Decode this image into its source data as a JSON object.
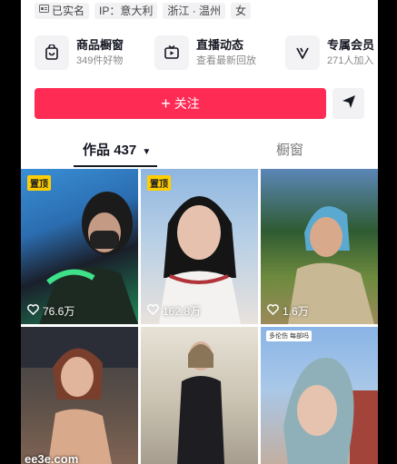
{
  "profile_tags": [
    {
      "icon": "id-card-icon",
      "label": "已实名"
    },
    {
      "icon": "",
      "label": "IP：意大利"
    },
    {
      "icon": "",
      "label": "浙江 · 温州"
    },
    {
      "icon": "",
      "label": "女"
    }
  ],
  "features": [
    {
      "title": "商品橱窗",
      "subtitle": "349件好物",
      "icon": "shopping-bag-icon"
    },
    {
      "title": "直播动态",
      "subtitle": "查看最新回放",
      "icon": "tv-play-icon"
    },
    {
      "title": "专属会员",
      "subtitle": "271人加入",
      "icon": "v-member-icon"
    }
  ],
  "follow_button": {
    "plus": "+",
    "label": "关注"
  },
  "tabs": {
    "works_label": "作品",
    "works_count": "437",
    "caret": "▼",
    "window_label": "橱窗"
  },
  "videos": [
    {
      "pinned": "置顶",
      "likes": "76.6万"
    },
    {
      "pinned": "置顶",
      "likes": "162.8万"
    },
    {
      "pinned": "",
      "likes": "1.6万"
    },
    {
      "pinned": "",
      "likes": ""
    },
    {
      "pinned": "",
      "likes": ""
    },
    {
      "pinned": "",
      "likes": "",
      "overlay_text": "多伦伤 每部吗"
    }
  ],
  "watermark": "ee3e.com",
  "colors": {
    "accent": "#fe2c55",
    "pinned": "#ffcd00"
  }
}
